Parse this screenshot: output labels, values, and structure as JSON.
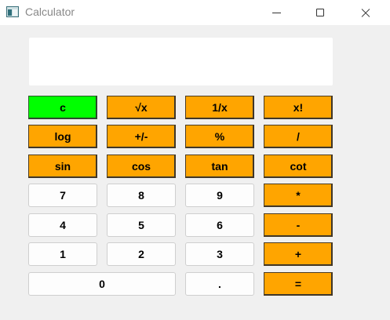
{
  "window": {
    "title": "Calculator",
    "controls": [
      "minimize",
      "maximize",
      "close"
    ]
  },
  "display": {
    "value": ""
  },
  "keys": {
    "clear": "c",
    "sqrt": "√x",
    "reciprocal": "1/x",
    "factorial": "x!",
    "log": "log",
    "negate": "+/-",
    "percent": "%",
    "divide": "/",
    "sin": "sin",
    "cos": "cos",
    "tan": "tan",
    "cot": "cot",
    "seven": "7",
    "eight": "8",
    "nine": "9",
    "multiply": "*",
    "four": "4",
    "five": "5",
    "six": "6",
    "subtract": "-",
    "one": "1",
    "two": "2",
    "three": "3",
    "add": "+",
    "zero": "0",
    "decimal": ".",
    "equals": "="
  },
  "colors": {
    "function_key": "#ffa500",
    "clear_key": "#00ff00",
    "digit_key": "#fdfdfd",
    "window_bg": "#f0f0f0"
  }
}
